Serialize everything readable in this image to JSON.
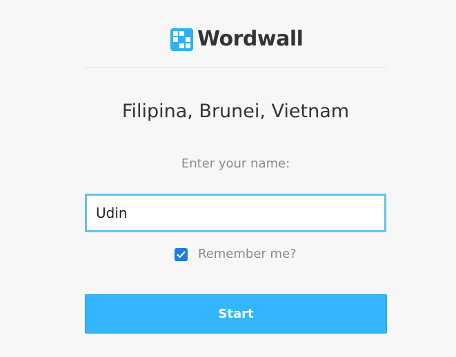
{
  "brand": {
    "name": "Wordwall",
    "logo_icon": "wordwall-grid-logo",
    "logo_color": "#2fb2f2"
  },
  "activity": {
    "title": "Filipina, Brunei, Vietnam"
  },
  "form": {
    "prompt": "Enter your name:",
    "name_value": "Udin",
    "remember_label": "Remember me?",
    "remember_checked": true,
    "start_label": "Start",
    "accent_color": "#34b5ff"
  }
}
